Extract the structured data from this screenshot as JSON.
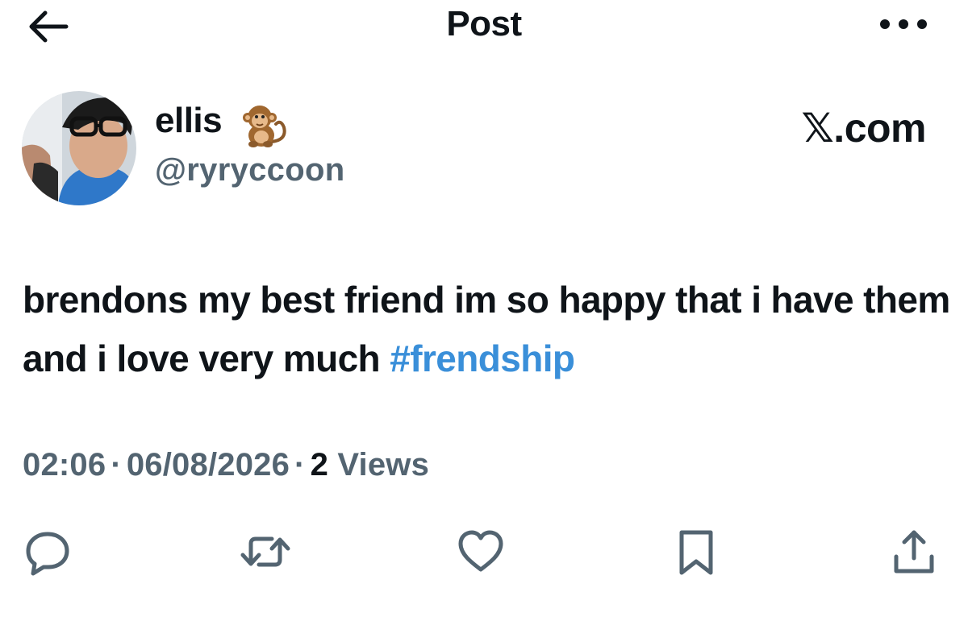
{
  "header": {
    "title": "Post",
    "back_icon": "arrow-left-icon",
    "more_icon": "more-horizontal-icon"
  },
  "author": {
    "display_name": "ellis",
    "name_emoji_icon": "monkey-emoji-icon",
    "handle": "@ryryccoon"
  },
  "brand": {
    "x_glyph": "𝕏",
    "domain_suffix": ".com"
  },
  "post": {
    "text": "brendons my best friend im so happy that i have them and i love very much ",
    "hashtag": "#frendship",
    "time": "02:06",
    "date": "06/08/2026",
    "separator": "·",
    "views_count": "2",
    "views_label": "Views"
  },
  "actions": [
    {
      "name": "reply",
      "icon": "comment-icon"
    },
    {
      "name": "repost",
      "icon": "repost-icon"
    },
    {
      "name": "like",
      "icon": "heart-icon"
    },
    {
      "name": "bookmark",
      "icon": "bookmark-icon"
    },
    {
      "name": "share",
      "icon": "share-icon"
    }
  ],
  "colors": {
    "text": "#0f1419",
    "secondary": "#536471",
    "link": "#3a8fd9",
    "background": "#ffffff"
  }
}
